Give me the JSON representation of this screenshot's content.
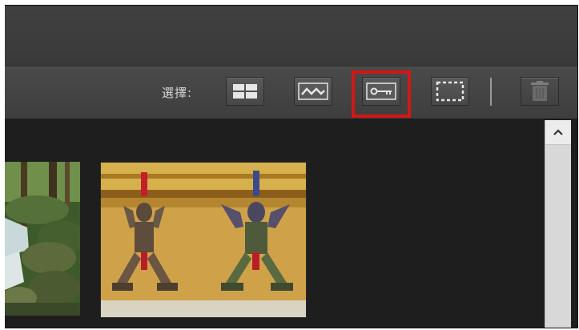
{
  "toolbar": {
    "select_label": "選擇:",
    "buttons": [
      {
        "icon": "grid-icon"
      },
      {
        "icon": "wave-icon"
      },
      {
        "icon": "key-icon",
        "highlighted": true,
        "highlight_color": "#d41616"
      },
      {
        "icon": "dashed-rectangle-icon"
      },
      {
        "icon": "trash-icon",
        "disabled": true
      }
    ]
  },
  "scrollbar": {
    "up_icon": "chevron-up-icon"
  },
  "thumbnails": [
    {
      "subject": "forest-waterfall"
    },
    {
      "subject": "temple-guardian-statues"
    }
  ]
}
